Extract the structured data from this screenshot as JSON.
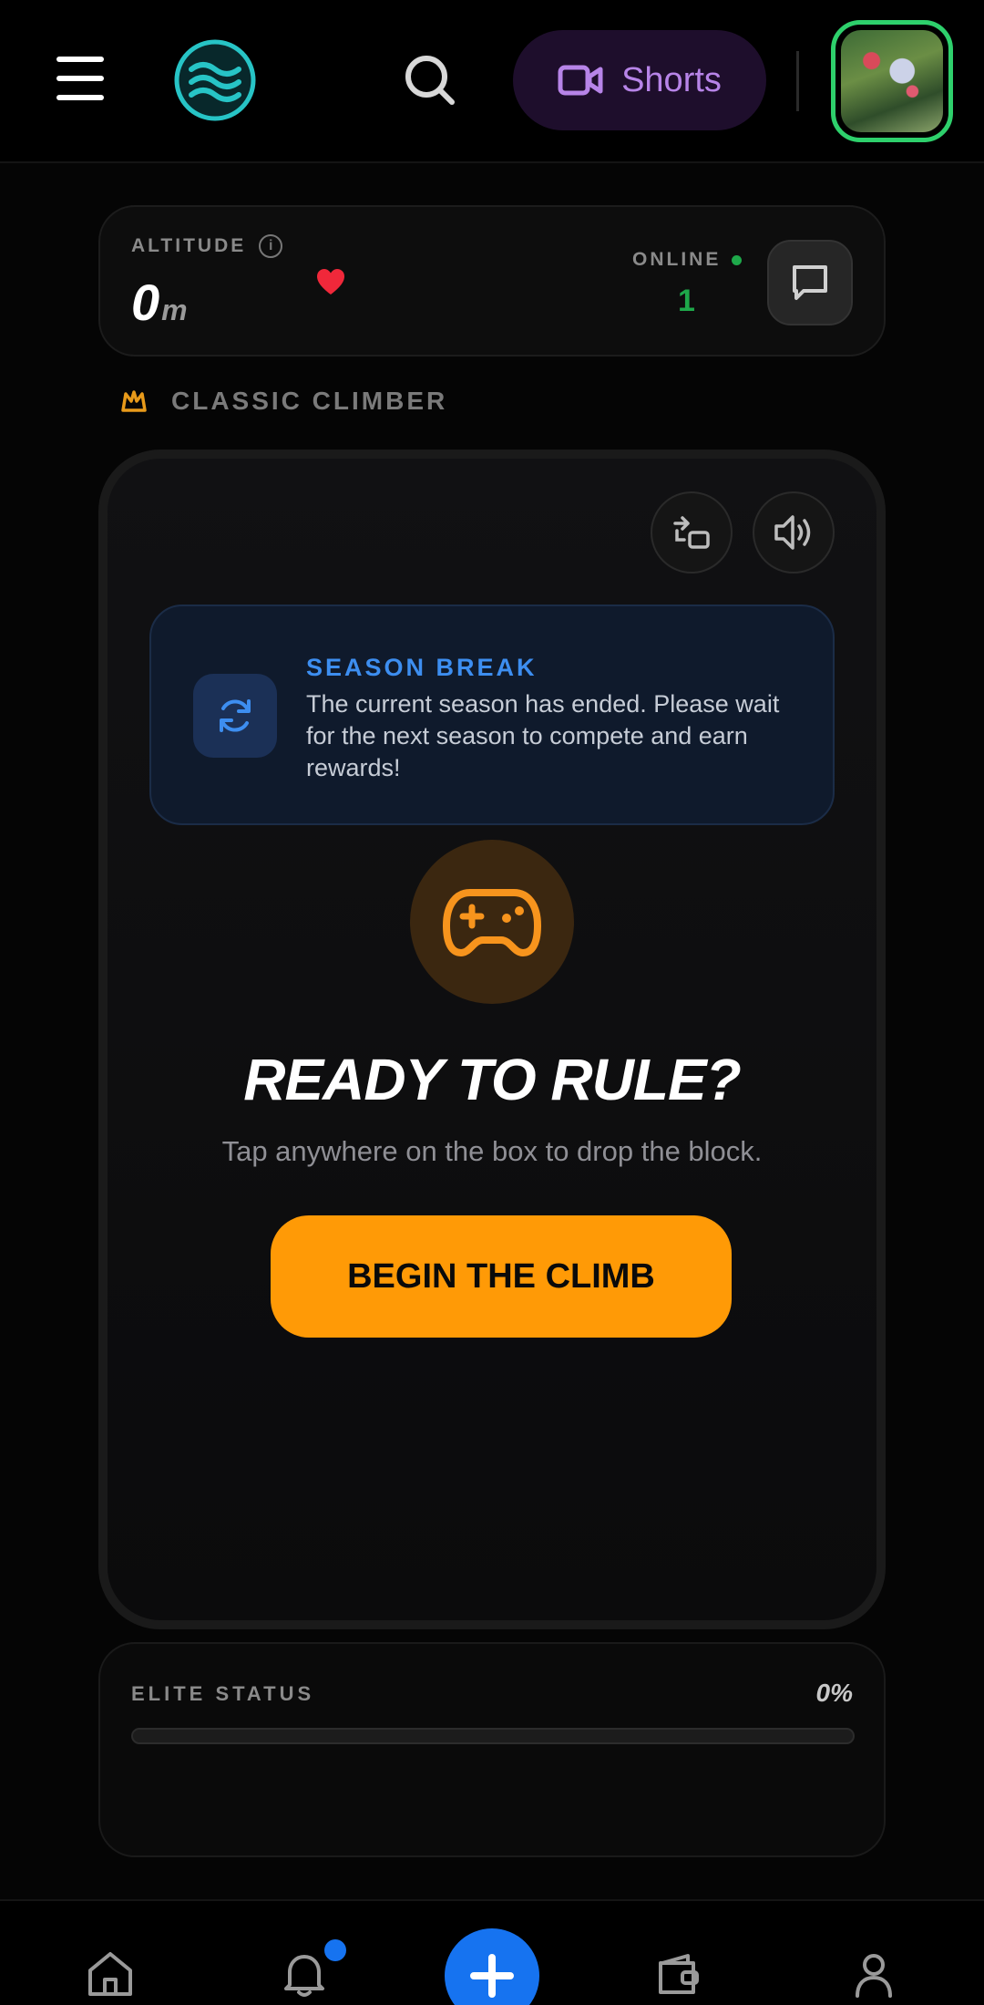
{
  "header": {
    "menu_icon": "hamburger-menu-icon",
    "logo_icon": "waves-logo-icon",
    "search_icon": "search-icon",
    "shorts_label": "Shorts",
    "shorts_icon": "video-camera-icon",
    "avatar_alt": "profile-avatar"
  },
  "altitude": {
    "label": "ALTITUDE",
    "value": "0",
    "unit": "m",
    "online_label": "ONLINE",
    "online_count": "1"
  },
  "mode": {
    "label": "CLASSIC CLIMBER"
  },
  "season": {
    "title": "SEASON BREAK",
    "message": "The current season has ended. Please wait for the next season to compete and earn rewards!"
  },
  "game": {
    "title": "READY TO RULE?",
    "subtitle": "Tap anywhere on the box to drop the block.",
    "button_label": "BEGIN THE CLIMB"
  },
  "elite": {
    "label": "ELITE STATUS",
    "value": "0%",
    "progress_fraction": 0
  },
  "nav": {
    "items": [
      "home-icon",
      "bell-icon",
      "plus-icon",
      "wallet-icon",
      "user-icon"
    ]
  },
  "colors": {
    "accent_orange": "#ff9a06",
    "accent_blue": "#1673f0",
    "online_green": "#1ea84a",
    "shorts_purple": "#b784e8"
  }
}
